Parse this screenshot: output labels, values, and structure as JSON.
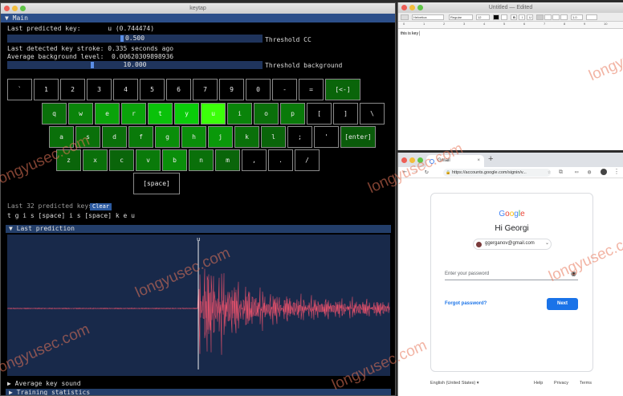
{
  "keytap": {
    "window_title": "keytap",
    "main_header": "Main",
    "last_predicted_label": "Last predicted key:",
    "last_predicted_value": "u (0.744474)",
    "threshold_cc": {
      "value_text": "0.500",
      "label": "Threshold CC",
      "fraction": 0.45
    },
    "last_stroke_text": "Last detected key stroke: 0.335 seconds ago",
    "avg_bg_text": "Average background level:  0.00620309898936",
    "threshold_bg": {
      "value_text": "10.000",
      "label": "Threshold background",
      "fraction": 0.33
    },
    "keyboard": {
      "rows": [
        [
          {
            "k": "`",
            "i": 0.0
          },
          {
            "k": "1",
            "i": 0.0
          },
          {
            "k": "2",
            "i": 0.0
          },
          {
            "k": "3",
            "i": 0.0
          },
          {
            "k": "4",
            "i": 0.0
          },
          {
            "k": "5",
            "i": 0.0
          },
          {
            "k": "6",
            "i": 0.0
          },
          {
            "k": "7",
            "i": 0.0
          },
          {
            "k": "9",
            "i": 0.0
          },
          {
            "k": "0",
            "i": 0.0
          },
          {
            "k": "-",
            "i": 0.0
          },
          {
            "k": "=",
            "i": 0.0
          },
          {
            "k": "[<-]",
            "i": 0.25
          }
        ],
        [
          {
            "k": "q",
            "i": 0.3
          },
          {
            "k": "w",
            "i": 0.4
          },
          {
            "k": "e",
            "i": 0.55
          },
          {
            "k": "r",
            "i": 0.55
          },
          {
            "k": "t",
            "i": 0.7
          },
          {
            "k": "y",
            "i": 0.75
          },
          {
            "k": "u",
            "i": 1.0
          },
          {
            "k": "i",
            "i": 0.4
          },
          {
            "k": "o",
            "i": 0.3
          },
          {
            "k": "p",
            "i": 0.35
          },
          {
            "k": "[",
            "i": 0.0
          },
          {
            "k": "]",
            "i": 0.0
          },
          {
            "k": "\\",
            "i": 0.0
          }
        ],
        [
          {
            "k": "a",
            "i": 0.3
          },
          {
            "k": "s",
            "i": 0.3
          },
          {
            "k": "d",
            "i": 0.3
          },
          {
            "k": "f",
            "i": 0.35
          },
          {
            "k": "g",
            "i": 0.45
          },
          {
            "k": "h",
            "i": 0.45
          },
          {
            "k": "j",
            "i": 0.5
          },
          {
            "k": "k",
            "i": 0.3
          },
          {
            "k": "l",
            "i": 0.25
          },
          {
            "k": ";",
            "i": 0.0
          },
          {
            "k": "'",
            "i": 0.0
          },
          {
            "k": "[enter]",
            "i": 0.2
          }
        ],
        [
          {
            "k": "z",
            "i": 0.25
          },
          {
            "k": "x",
            "i": 0.3
          },
          {
            "k": "c",
            "i": 0.25
          },
          {
            "k": "v",
            "i": 0.35
          },
          {
            "k": "b",
            "i": 0.45
          },
          {
            "k": "n",
            "i": 0.3
          },
          {
            "k": "m",
            "i": 0.25
          },
          {
            "k": ",",
            "i": 0.0
          },
          {
            "k": ".",
            "i": 0.0
          },
          {
            "k": "/",
            "i": 0.0
          }
        ],
        [
          {
            "k": "[space]",
            "i": 0.0
          }
        ]
      ]
    },
    "last_predicted_keys_label": "Last 32 predicted keys:",
    "clear_button": "Clear",
    "predicted_keys": "t g i s [space] i s [space] k e u",
    "last_prediction_header": "Last prediction",
    "marker_label": "u",
    "average_key_sound_header": "Average key sound",
    "training_stats_header": "Training statistics",
    "colors": {
      "header": "#2c4f8a",
      "wave": "#e0506a",
      "key_hot": "#39ff14"
    }
  },
  "textedit": {
    "window_title": "Untitled — Edited",
    "font_name": "Helvetica",
    "font_style": "Regular",
    "font_size": "12",
    "spacing": "1.0",
    "ruler_ticks": [
      "0",
      "1",
      "2",
      "3",
      "4",
      "5",
      "6",
      "7",
      "8",
      "9",
      "10"
    ],
    "body_text": "this is key│"
  },
  "chrome": {
    "tab_title": "Gmail",
    "new_tab": "+",
    "url": "https://accounts.google.com/signin/v...",
    "google_logo": "Google",
    "greeting": "Hi Georgi",
    "account_email": "ggerganov@gmail.com",
    "password_placeholder": "Enter your password",
    "forgot_password": "Forgot password?",
    "next_button": "Next",
    "footer_language": "English (United States)",
    "footer_help": "Help",
    "footer_privacy": "Privacy",
    "footer_terms": "Terms"
  },
  "watermark": "longyusec.com"
}
